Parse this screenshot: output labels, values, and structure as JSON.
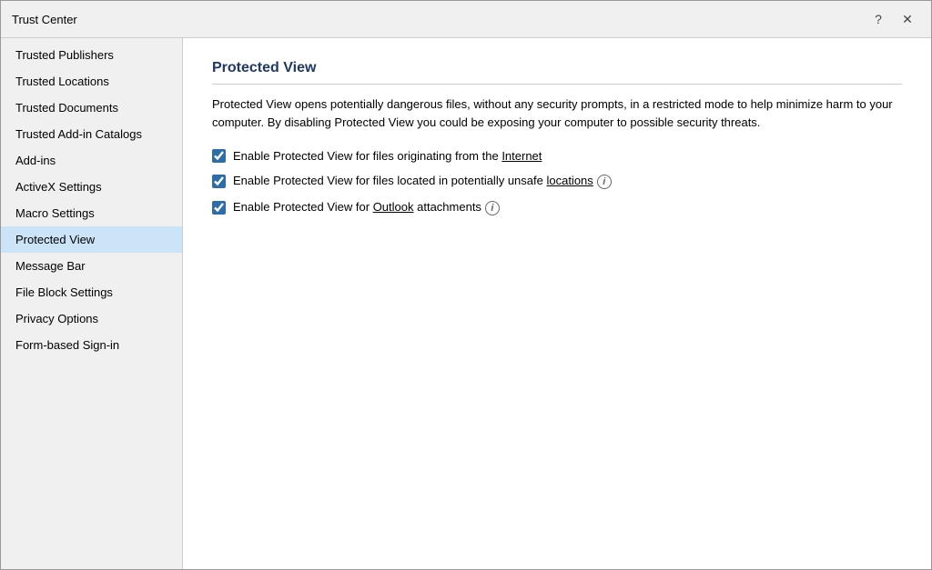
{
  "window": {
    "title": "Trust Center",
    "help_button": "?",
    "close_button": "✕"
  },
  "sidebar": {
    "items": [
      {
        "id": "trusted-publishers",
        "label": "Trusted Publishers",
        "active": false
      },
      {
        "id": "trusted-locations",
        "label": "Trusted Locations",
        "active": false
      },
      {
        "id": "trusted-documents",
        "label": "Trusted Documents",
        "active": false
      },
      {
        "id": "trusted-add-in-catalogs",
        "label": "Trusted Add-in Catalogs",
        "active": false
      },
      {
        "id": "add-ins",
        "label": "Add-ins",
        "active": false
      },
      {
        "id": "activex-settings",
        "label": "ActiveX Settings",
        "active": false
      },
      {
        "id": "macro-settings",
        "label": "Macro Settings",
        "active": false
      },
      {
        "id": "protected-view",
        "label": "Protected View",
        "active": true
      },
      {
        "id": "message-bar",
        "label": "Message Bar",
        "active": false
      },
      {
        "id": "file-block-settings",
        "label": "File Block Settings",
        "active": false
      },
      {
        "id": "privacy-options",
        "label": "Privacy Options",
        "active": false
      },
      {
        "id": "form-based-sign-in",
        "label": "Form-based Sign-in",
        "active": false
      }
    ]
  },
  "main": {
    "section_title": "Protected View",
    "description": "Protected View opens potentially dangerous files, without any security prompts, in a restricted mode to help minimize harm to your computer. By disabling Protected View you could be exposing your computer to possible security threats.",
    "checkboxes": [
      {
        "id": "cb-internet",
        "checked": true,
        "label_before": "Enable Protected View for files originating from the ",
        "underline_word": "Internet",
        "label_after": "",
        "has_info": false
      },
      {
        "id": "cb-unsafe-locations",
        "checked": true,
        "label_before": "Enable Protected View for files located in potentially unsafe ",
        "underline_word": "locations",
        "label_after": "",
        "has_info": true
      },
      {
        "id": "cb-outlook",
        "checked": true,
        "label_before": "Enable Protected View for ",
        "underline_word": "Outlook",
        "label_after": " attachments",
        "has_info": true
      }
    ]
  }
}
